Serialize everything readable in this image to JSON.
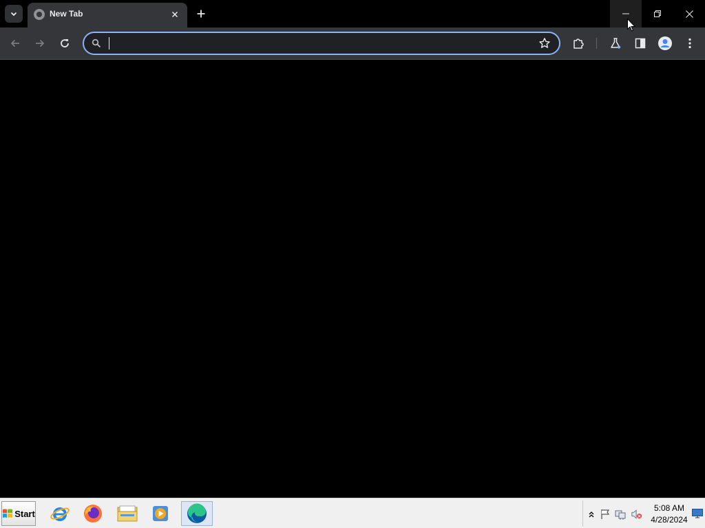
{
  "browser": {
    "tab": {
      "title": "New Tab",
      "active": true
    },
    "omnibox": {
      "value": "",
      "placeholder": "",
      "focused": true
    },
    "accent_color": "#8ab4f8",
    "icons": {
      "tab_search": "chevron-down-icon",
      "tab_close": "close-icon",
      "new_tab": "plus-icon",
      "back": "arrow-left-icon",
      "forward": "arrow-right-icon",
      "reload": "reload-icon",
      "omnibox_search": "search-icon",
      "bookmark": "star-icon",
      "extensions": "puzzle-icon",
      "labs": "flask-icon",
      "side_panel": "side-panel-icon",
      "profile": "avatar-icon",
      "menu": "kebab-menu-icon"
    },
    "window_controls": [
      "minimize-icon",
      "restore-icon",
      "close-icon"
    ]
  },
  "taskbar": {
    "start_label": "Start",
    "apps": [
      {
        "name": "Internet Explorer",
        "icon": "ie-icon"
      },
      {
        "name": "Firefox",
        "icon": "firefox-icon"
      },
      {
        "name": "File Explorer",
        "icon": "folder-icon"
      },
      {
        "name": "Media Player",
        "icon": "media-player-icon"
      },
      {
        "name": "Microsoft Edge",
        "icon": "edge-icon",
        "active": true
      }
    ],
    "tray": {
      "icons": [
        "chevron-up-icon",
        "flag-icon",
        "network-icon",
        "volume-muted-icon"
      ],
      "time": "5:08 AM",
      "date": "4/28/2024"
    }
  }
}
